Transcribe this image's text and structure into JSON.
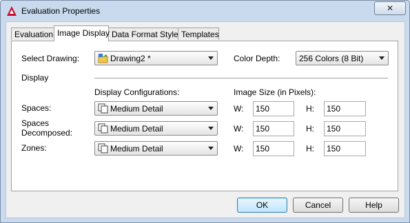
{
  "window": {
    "title": "Evaluation Properties",
    "close_glyph": "✕"
  },
  "tabs": [
    {
      "label": "Evaluation",
      "active": false
    },
    {
      "label": "Image Display",
      "active": true
    },
    {
      "label": "Data Format Styles",
      "active": false
    },
    {
      "label": "Templates",
      "active": false
    }
  ],
  "panel": {
    "select_drawing_label": "Select Drawing:",
    "select_drawing_value": "Drawing2 *",
    "color_depth_label": "Color Depth:",
    "color_depth_value": "256 Colors (8 Bit)",
    "display_section_label": "Display",
    "display_configs_header": "Display Configurations:",
    "image_size_header": "Image Size (in Pixels):",
    "w_label": "W:",
    "h_label": "H:",
    "rows": [
      {
        "label": "Spaces:",
        "config": "Medium Detail",
        "w": "150",
        "h": "150"
      },
      {
        "label": "Spaces Decomposed:",
        "config": "Medium Detail",
        "w": "150",
        "h": "150"
      },
      {
        "label": "Zones:",
        "config": "Medium Detail",
        "w": "150",
        "h": "150"
      }
    ]
  },
  "buttons": {
    "ok": "OK",
    "cancel": "Cancel",
    "help": "Help"
  },
  "colors": {
    "titlebar": "#c9daee",
    "app_icon": "#c8102e",
    "default_button": "#bee6fd"
  }
}
